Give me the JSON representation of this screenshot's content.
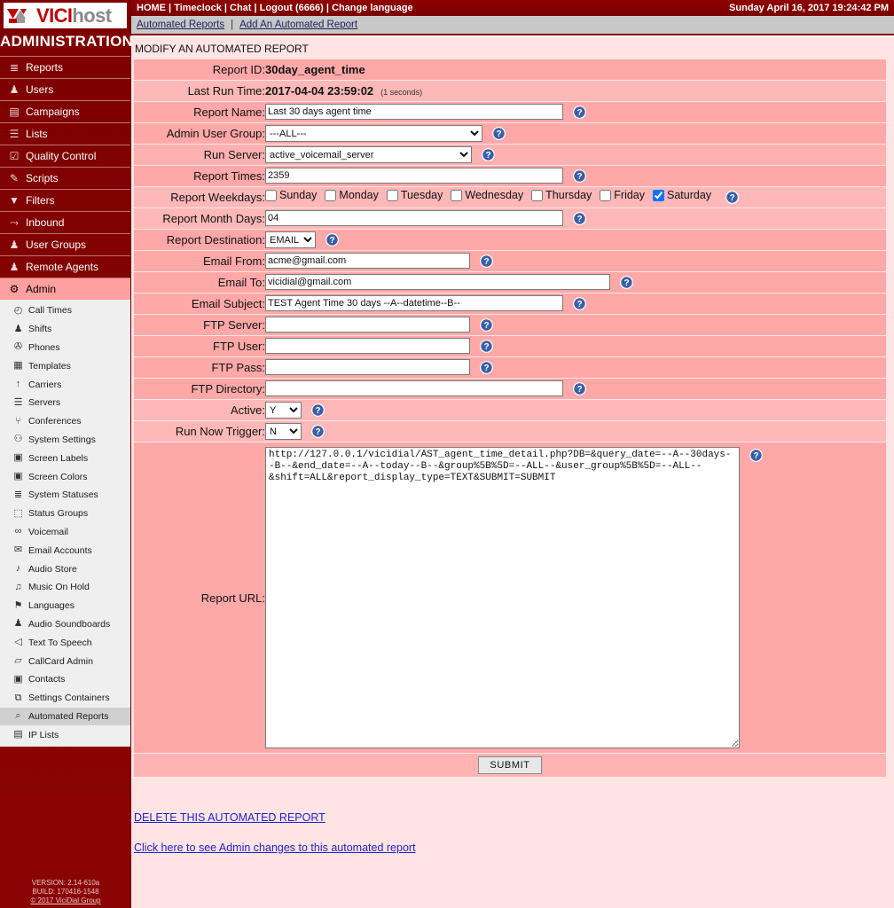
{
  "topbar": {
    "links": [
      "HOME",
      "Timeclock",
      "Chat",
      "Logout (6666)",
      "Change language"
    ],
    "separator": " | ",
    "datetime": "Sunday April 16, 2017 19:24:42 PM"
  },
  "subbar": {
    "link1": "Automated Reports",
    "sep": "|",
    "link2": "Add An Automated Report"
  },
  "sidebar": {
    "logo": {
      "vici": "VICI",
      "host": "host"
    },
    "admin_title": "ADMINISTRATION",
    "items": [
      {
        "label": "Reports",
        "icon": "reports-icon",
        "glyph": "≣"
      },
      {
        "label": "Users",
        "icon": "users-icon",
        "glyph": "♟"
      },
      {
        "label": "Campaigns",
        "icon": "campaigns-icon",
        "glyph": "▤"
      },
      {
        "label": "Lists",
        "icon": "lists-icon",
        "glyph": "☰"
      },
      {
        "label": "Quality Control",
        "icon": "quality-control-icon",
        "glyph": "☑"
      },
      {
        "label": "Scripts",
        "icon": "scripts-icon",
        "glyph": "✎"
      },
      {
        "label": "Filters",
        "icon": "filters-icon",
        "glyph": "▼"
      },
      {
        "label": "Inbound",
        "icon": "inbound-icon",
        "glyph": "⤳"
      },
      {
        "label": "User Groups",
        "icon": "user-groups-icon",
        "glyph": "♟"
      },
      {
        "label": "Remote Agents",
        "icon": "remote-agents-icon",
        "glyph": "♟"
      },
      {
        "label": "Admin",
        "icon": "gear-icon",
        "glyph": "⚙",
        "active": true
      }
    ],
    "submenu": [
      {
        "label": "Call Times",
        "icon": "clock-icon",
        "glyph": "◴"
      },
      {
        "label": "Shifts",
        "icon": "shifts-icon",
        "glyph": "♟"
      },
      {
        "label": "Phones",
        "icon": "phones-icon",
        "glyph": "✇"
      },
      {
        "label": "Templates",
        "icon": "templates-icon",
        "glyph": "▦"
      },
      {
        "label": "Carriers",
        "icon": "carriers-icon",
        "glyph": "↑"
      },
      {
        "label": "Servers",
        "icon": "servers-icon",
        "glyph": "☰"
      },
      {
        "label": "Conferences",
        "icon": "conferences-icon",
        "glyph": "⑂"
      },
      {
        "label": "System Settings",
        "icon": "system-settings-icon",
        "glyph": "⚇"
      },
      {
        "label": "Screen Labels",
        "icon": "screen-labels-icon",
        "glyph": "▣"
      },
      {
        "label": "Screen Colors",
        "icon": "screen-colors-icon",
        "glyph": "▣"
      },
      {
        "label": "System Statuses",
        "icon": "system-statuses-icon",
        "glyph": "≣"
      },
      {
        "label": "Status Groups",
        "icon": "status-groups-icon",
        "glyph": "⬚"
      },
      {
        "label": "Voicemail",
        "icon": "voicemail-icon",
        "glyph": "∞"
      },
      {
        "label": "Email Accounts",
        "icon": "envelope-icon",
        "glyph": "✉"
      },
      {
        "label": "Audio Store",
        "icon": "audio-store-icon",
        "glyph": "♪"
      },
      {
        "label": "Music On Hold",
        "icon": "music-on-hold-icon",
        "glyph": "♫"
      },
      {
        "label": "Languages",
        "icon": "languages-icon",
        "glyph": "⚑"
      },
      {
        "label": "Audio Soundboards",
        "icon": "audio-soundboards-icon",
        "glyph": "♟"
      },
      {
        "label": "Text To Speech",
        "icon": "text-to-speech-icon",
        "glyph": "◁"
      },
      {
        "label": "CallCard Admin",
        "icon": "callcard-admin-icon",
        "glyph": "▱"
      },
      {
        "label": "Contacts",
        "icon": "contacts-icon",
        "glyph": "▣"
      },
      {
        "label": "Settings Containers",
        "icon": "settings-containers-icon",
        "glyph": "⧉"
      },
      {
        "label": "Automated Reports",
        "icon": "automated-reports-icon",
        "glyph": "⌕",
        "selected": true
      },
      {
        "label": "IP Lists",
        "icon": "ip-lists-icon",
        "glyph": "▤"
      }
    ],
    "footer": {
      "version": "VERSION: 2.14-610a",
      "build": "BUILD: 170416-1548",
      "copyright": "© 2017 ViciDial Group"
    }
  },
  "main": {
    "heading": "MODIFY AN AUTOMATED REPORT",
    "fields": {
      "report_id_label": "Report ID:",
      "report_id_value": "30day_agent_time",
      "last_run_label": "Last Run Time:",
      "last_run_value": "2017-04-04 23:59:02",
      "last_run_note": "(1 seconds)",
      "report_name_label": "Report Name:",
      "report_name_value": "Last 30 days agent time",
      "admin_user_group_label": "Admin User Group:",
      "admin_user_group_value": "---ALL---",
      "run_server_label": "Run Server:",
      "run_server_value": "active_voicemail_server",
      "report_times_label": "Report Times:",
      "report_times_value": "2359",
      "report_weekdays_label": "Report Weekdays:",
      "weekdays": [
        {
          "label": "Sunday",
          "checked": false
        },
        {
          "label": "Monday",
          "checked": false
        },
        {
          "label": "Tuesday",
          "checked": false
        },
        {
          "label": "Wednesday",
          "checked": false
        },
        {
          "label": "Thursday",
          "checked": false
        },
        {
          "label": "Friday",
          "checked": false
        },
        {
          "label": "Saturday",
          "checked": true
        }
      ],
      "report_month_days_label": "Report Month Days:",
      "report_month_days_value": "04",
      "report_destination_label": "Report Destination:",
      "report_destination_value": "EMAIL",
      "email_from_label": "Email From:",
      "email_from_value": "acme@gmail.com",
      "email_to_label": "Email To:",
      "email_to_value": "vicidial@gmail.com",
      "email_subject_label": "Email Subject:",
      "email_subject_value": "TEST Agent Time 30 days --A--datetime--B--",
      "ftp_server_label": "FTP Server:",
      "ftp_server_value": "",
      "ftp_user_label": "FTP User:",
      "ftp_user_value": "",
      "ftp_pass_label": "FTP Pass:",
      "ftp_pass_value": "",
      "ftp_directory_label": "FTP Directory:",
      "ftp_directory_value": "",
      "active_label": "Active:",
      "active_value": "Y",
      "run_now_trigger_label": "Run Now Trigger:",
      "run_now_trigger_value": "N",
      "report_url_label": "Report URL:",
      "report_url_value": "http://127.0.0.1/vicidial/AST_agent_time_detail.php?DB=&query_date=--A--30days--B--&end_date=--A--today--B--&group%5B%5D=--ALL--&user_group%5B%5D=--ALL--&shift=ALL&report_display_type=TEXT&SUBMIT=SUBMIT"
    },
    "submit_label": "SUBMIT",
    "delete_link": "DELETE THIS AUTOMATED REPORT",
    "changes_link": "Click here to see Admin changes to this automated report"
  }
}
